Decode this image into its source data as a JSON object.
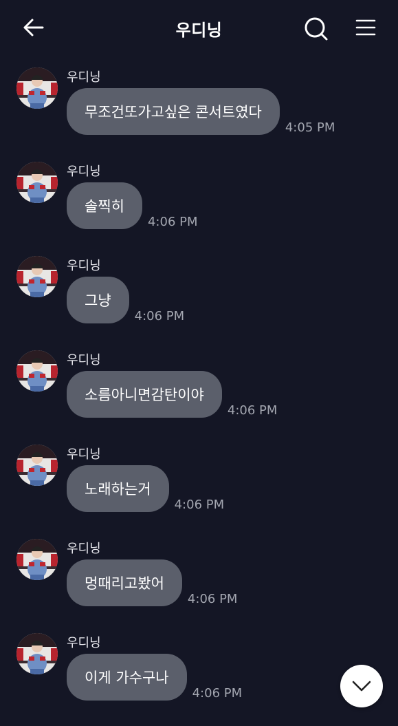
{
  "header": {
    "title": "우디닝",
    "back_icon": "arrow-left-icon",
    "search_icon": "search-icon",
    "menu_icon": "hamburger-menu-icon"
  },
  "messages": [
    {
      "sender": "우디닝",
      "text": "무조건또가고싶은 콘서트였다",
      "time": "4:05 PM"
    },
    {
      "sender": "우디닝",
      "text": "솔찍히",
      "time": "4:06 PM"
    },
    {
      "sender": "우디닝",
      "text": "그냥",
      "time": "4:06 PM"
    },
    {
      "sender": "우디닝",
      "text": "소름아니면감탄이야",
      "time": "4:06 PM"
    },
    {
      "sender": "우디닝",
      "text": "노래하는거",
      "time": "4:06 PM"
    },
    {
      "sender": "우디닝",
      "text": "멍때리고봤어",
      "time": "4:06 PM"
    },
    {
      "sender": "우디닝",
      "text": "이게 가수구나",
      "time": "4:06 PM"
    }
  ],
  "scroll_button_icon": "chevron-down-icon",
  "colors": {
    "background": "#141625",
    "bubble": "#5b5f6b",
    "timestamp": "#a3a6b0"
  }
}
